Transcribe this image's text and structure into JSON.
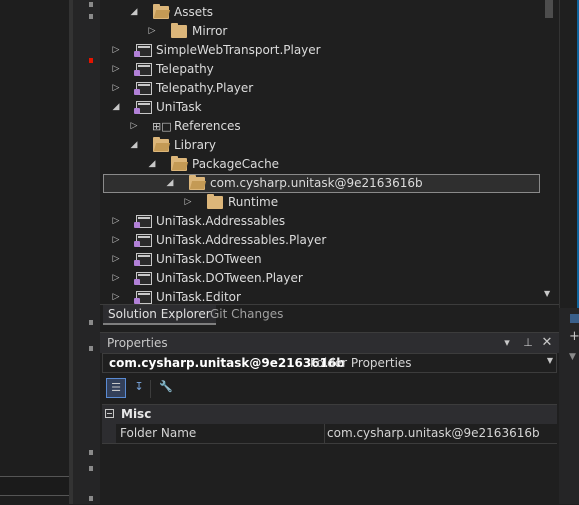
{
  "explorer": {
    "items": [
      {
        "label": "Assets",
        "kind": "folder",
        "expanded": true
      },
      {
        "label": "Mirror",
        "kind": "folder",
        "expanded": false
      },
      {
        "label": "SimpleWebTransport.Player",
        "kind": "project",
        "expanded": false
      },
      {
        "label": "Telepathy",
        "kind": "project",
        "expanded": false
      },
      {
        "label": "Telepathy.Player",
        "kind": "project",
        "expanded": false
      },
      {
        "label": "UniTask",
        "kind": "project",
        "expanded": true
      },
      {
        "label": "References",
        "kind": "references",
        "expanded": false
      },
      {
        "label": "Library",
        "kind": "folder",
        "expanded": true
      },
      {
        "label": "PackageCache",
        "kind": "folder",
        "expanded": true
      },
      {
        "label": "com.cysharp.unitask@9e2163616b",
        "kind": "folder",
        "expanded": true,
        "selected": true
      },
      {
        "label": "Runtime",
        "kind": "folder",
        "expanded": false
      },
      {
        "label": "UniTask.Addressables",
        "kind": "project",
        "expanded": false
      },
      {
        "label": "UniTask.Addressables.Player",
        "kind": "project",
        "expanded": false
      },
      {
        "label": "UniTask.DOTween",
        "kind": "project",
        "expanded": false
      },
      {
        "label": "UniTask.DOTween.Player",
        "kind": "project",
        "expanded": false
      },
      {
        "label": "UniTask.Editor",
        "kind": "project",
        "expanded": false
      }
    ]
  },
  "tabs": {
    "solution_explorer": "Solution Explorer",
    "git_changes": "Git Changes"
  },
  "properties": {
    "title": "Properties",
    "object_name": "com.cysharp.unitask@9e2163616b",
    "object_type": "Folder Properties",
    "category": "Misc",
    "rows": [
      {
        "name": "Folder Name",
        "value": "com.cysharp.unitask@9e2163616b"
      }
    ]
  },
  "icons": {
    "collapsed": "chevron-right-icon",
    "expanded": "chevron-down-icon",
    "folder": "folder-icon",
    "project": "csharp-project-icon",
    "references": "references-icon",
    "pin": "pin-icon",
    "close": "close-icon",
    "categorized": "categorized-view-icon",
    "alphabetical": "alphabetical-sort-icon",
    "property_pages": "wrench-icon"
  },
  "colors": {
    "background": "#1f1f1f",
    "folder": "#dcb67a",
    "project_accent": "#b180d7",
    "selection_outline": "#8a8a8a",
    "accent_blue": "#0e639c"
  }
}
